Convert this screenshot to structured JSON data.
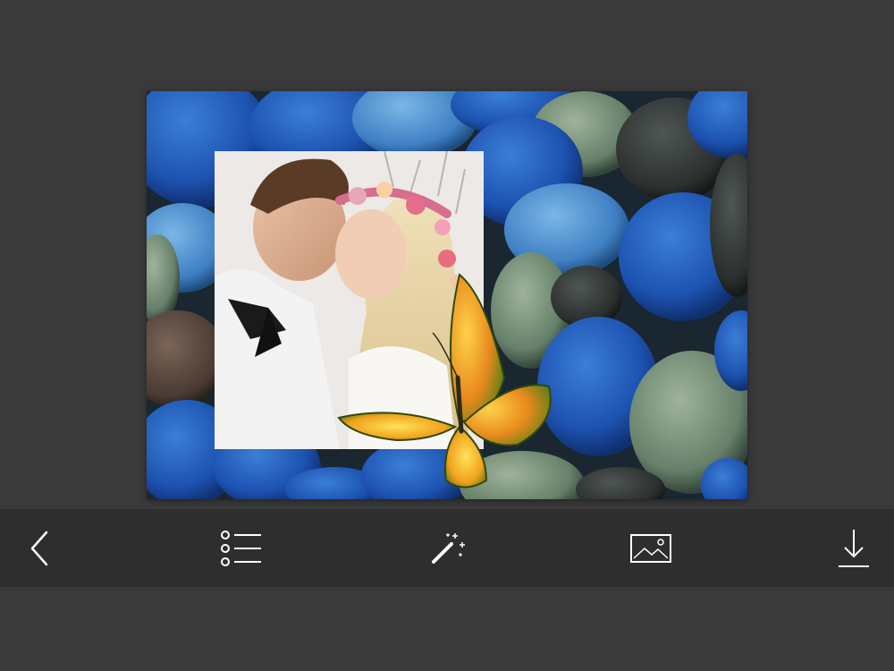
{
  "editor": {
    "icon_color": "#ffffff",
    "toolbar_background": "#2e2e2e",
    "page_background": "#3a3a3a"
  },
  "toolbar": {
    "items": [
      {
        "icon": "back-chevron-icon"
      },
      {
        "icon": "list-icon"
      },
      {
        "icon": "magic-wand-icon"
      },
      {
        "icon": "image-icon"
      },
      {
        "icon": "download-icon"
      }
    ]
  },
  "frame": {
    "theme": "blue pebbles frame",
    "decoration": "butterfly"
  }
}
